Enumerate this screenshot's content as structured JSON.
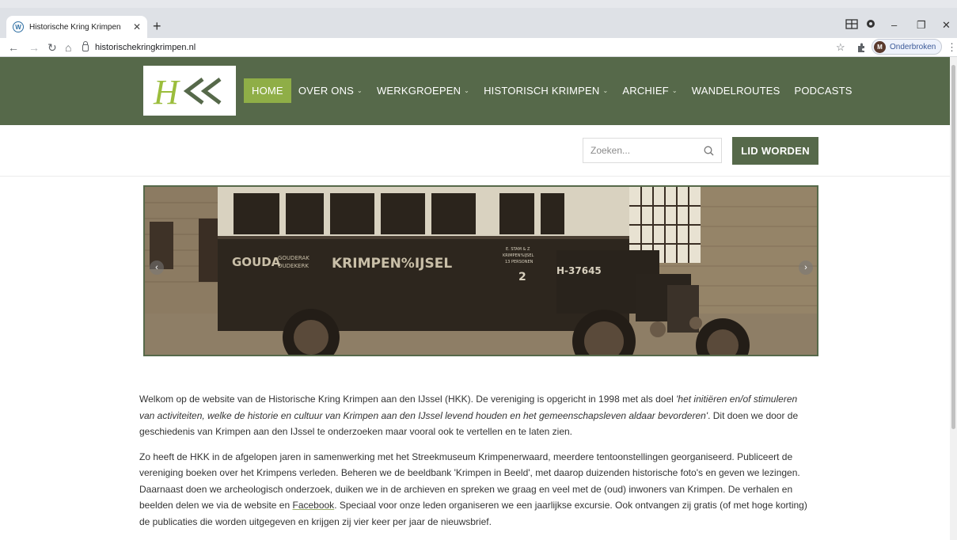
{
  "browser": {
    "tab_title": "Historische Kring Krimpen",
    "url": "historischekringkrimpen.nl",
    "profile_label": "Onderbroken",
    "profile_initial": "M",
    "tab_icon": "wordpress-icon"
  },
  "site": {
    "logo_text": "HKK",
    "nav": [
      {
        "label": "HOME",
        "active": true,
        "dropdown": false
      },
      {
        "label": "OVER ONS",
        "active": false,
        "dropdown": true
      },
      {
        "label": "WERKGROEPEN",
        "active": false,
        "dropdown": true
      },
      {
        "label": "HISTORISCH KRIMPEN",
        "active": false,
        "dropdown": true
      },
      {
        "label": "ARCHIEF",
        "active": false,
        "dropdown": true
      },
      {
        "label": "WANDELROUTES",
        "active": false,
        "dropdown": false
      },
      {
        "label": "PODCASTS",
        "active": false,
        "dropdown": false
      }
    ],
    "search_placeholder": "Zoeken...",
    "join_button": "LID WORDEN",
    "colors": {
      "header": "#56694a",
      "active_nav": "#8fae47"
    }
  },
  "slide": {
    "bus_text": {
      "left": "GOUDA",
      "middle_top": "GOUDERAK",
      "middle_bottom": "OUDEKERK",
      "main": "KRIMPEN%IJSEL",
      "plate": "H-37645",
      "sign_line1": "E. STAM & Z",
      "sign_line2": "KRIMPEN%IJSEL",
      "sign_line3": "13 PERSONEN",
      "number": "2"
    }
  },
  "intro": {
    "p1_start": "Welkom op de website van de Historische Kring Krimpen aan den IJssel (HKK). De vereniging is opgericht in 1998 met als doel ",
    "p1_quote": "'het initiëren en/of stimuleren van activiteiten, welke de historie en cultuur van Krimpen aan den IJssel levend houden en het gemeenschapsleven aldaar bevorderen'",
    "p1_end": ". Dit doen we door de geschiedenis van Krimpen aan den IJssel te onderzoeken maar vooral ook te vertellen en te laten zien.",
    "p2_start": "Zo heeft de HKK in de afgelopen jaren in samenwerking met het Streekmuseum Krimpenerwaard, meerdere tentoonstellingen georganiseerd. Publiceert de vereniging boeken over het Krimpens verleden. Beheren we de beeldbank 'Krimpen in Beeld', met daarop duizenden historische foto's en geven we lezingen. Daarnaast doen we archeologisch onderzoek, duiken we in de archieven en spreken we graag en veel met de (oud) inwoners van Krimpen. De verhalen en beelden delen we via de website en ",
    "p2_link": "Facebook",
    "p2_end": ". Speciaal voor onze leden organiseren we een jaarlijkse excursie. Ook ontvangen zij gratis (of met hoge korting) de publicaties die worden uitgegeven en krijgen zij vier keer per jaar de nieuwsbrief."
  }
}
